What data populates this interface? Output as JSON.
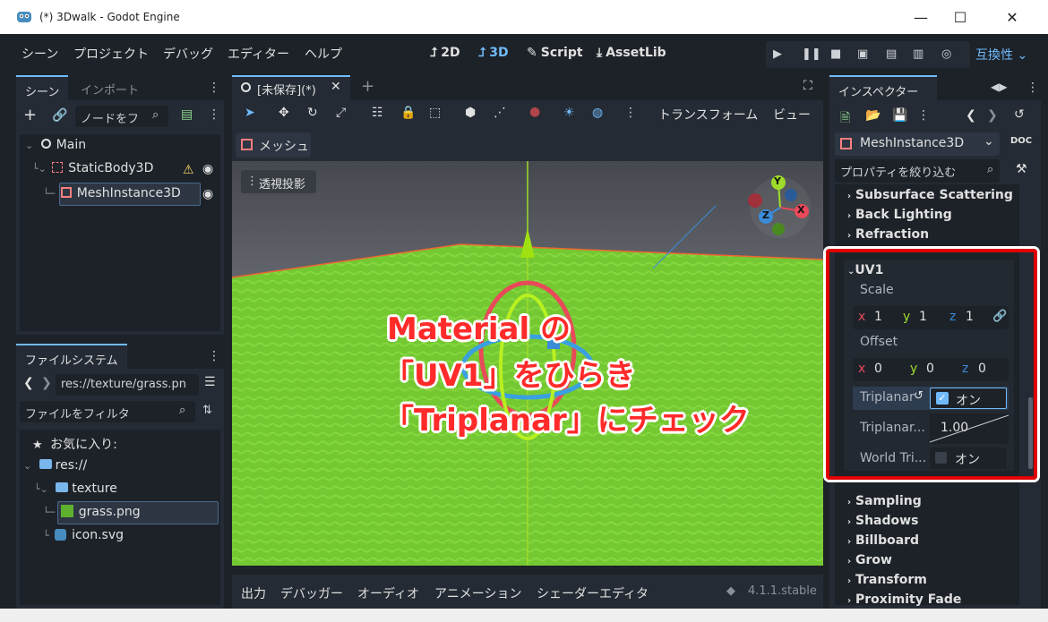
{
  "window": {
    "title": "(*) 3Dwalk - Godot Engine",
    "minimize": "—",
    "maximize": "☐",
    "close": "✕"
  },
  "menu": {
    "items": [
      "シーン",
      "プロジェクト",
      "デバッグ",
      "エディター",
      "ヘルプ"
    ],
    "workspaces": [
      {
        "icon": "2d-icon",
        "label": "2D"
      },
      {
        "icon": "3d-icon",
        "label": "3D"
      },
      {
        "icon": "script-icon",
        "label": "Script"
      },
      {
        "icon": "assetlib-icon",
        "label": "AssetLib"
      }
    ],
    "renderer": "互換性 ⌄"
  },
  "scene_dock": {
    "tabs": [
      "シーン",
      "インポート"
    ],
    "filter_placeholder": "ノードをフ",
    "nodes": [
      {
        "label": "Main"
      },
      {
        "label": "StaticBody3D"
      },
      {
        "label": "MeshInstance3D"
      }
    ]
  },
  "filesystem_dock": {
    "tab": "ファイルシステム",
    "path": "res://texture/grass.pn",
    "filter_placeholder": "ファイルをフィルタ",
    "items": [
      {
        "label": "お気に入り:"
      },
      {
        "label": "res://"
      },
      {
        "label": "texture"
      },
      {
        "label": "grass.png"
      },
      {
        "label": "icon.svg"
      }
    ]
  },
  "editor": {
    "scene_tab": "[未保存](*)",
    "toolbar_transform": "トランスフォーム",
    "toolbar_view": "ビュー",
    "mesh_menu": "メッシュ",
    "perspective_label": "透視投影",
    "gizmo": {
      "x": "X",
      "y": "Y",
      "z": "Z"
    }
  },
  "bottom_panel": {
    "tabs": [
      "出力",
      "デバッガー",
      "オーディオ",
      "アニメーション",
      "シェーダーエディタ"
    ],
    "version": "4.1.1.stable"
  },
  "inspector": {
    "tab": "インスペクター",
    "node_name": "MeshInstance3D",
    "filter_placeholder": "プロパティを絞り込む",
    "doc_label": "DOC",
    "sections_top": [
      "Subsurface Scattering",
      "Back Lighting",
      "Refraction"
    ],
    "uv1": {
      "title": "UV1",
      "scale_label": "Scale",
      "scale": {
        "x": "1",
        "y": "1",
        "z": "1"
      },
      "offset_label": "Offset",
      "offset": {
        "x": "0",
        "y": "0",
        "z": "0"
      },
      "triplanar_label": "Triplanar",
      "triplanar_value": "オン",
      "triplanar_sharpness_label": "Triplanar...",
      "triplanar_sharpness_value": "1.00",
      "world_triplanar_label": "World Tri...",
      "world_triplanar_value": "オン"
    },
    "sections_bottom": [
      "Sampling",
      "Shadows",
      "Billboard",
      "Grow",
      "Transform",
      "Proximity Fade"
    ]
  },
  "annotation": {
    "lines": [
      "Material の",
      "「UV1」をひらき",
      "「Triplanar」にチェック"
    ],
    "color": "#ff2a2a"
  }
}
